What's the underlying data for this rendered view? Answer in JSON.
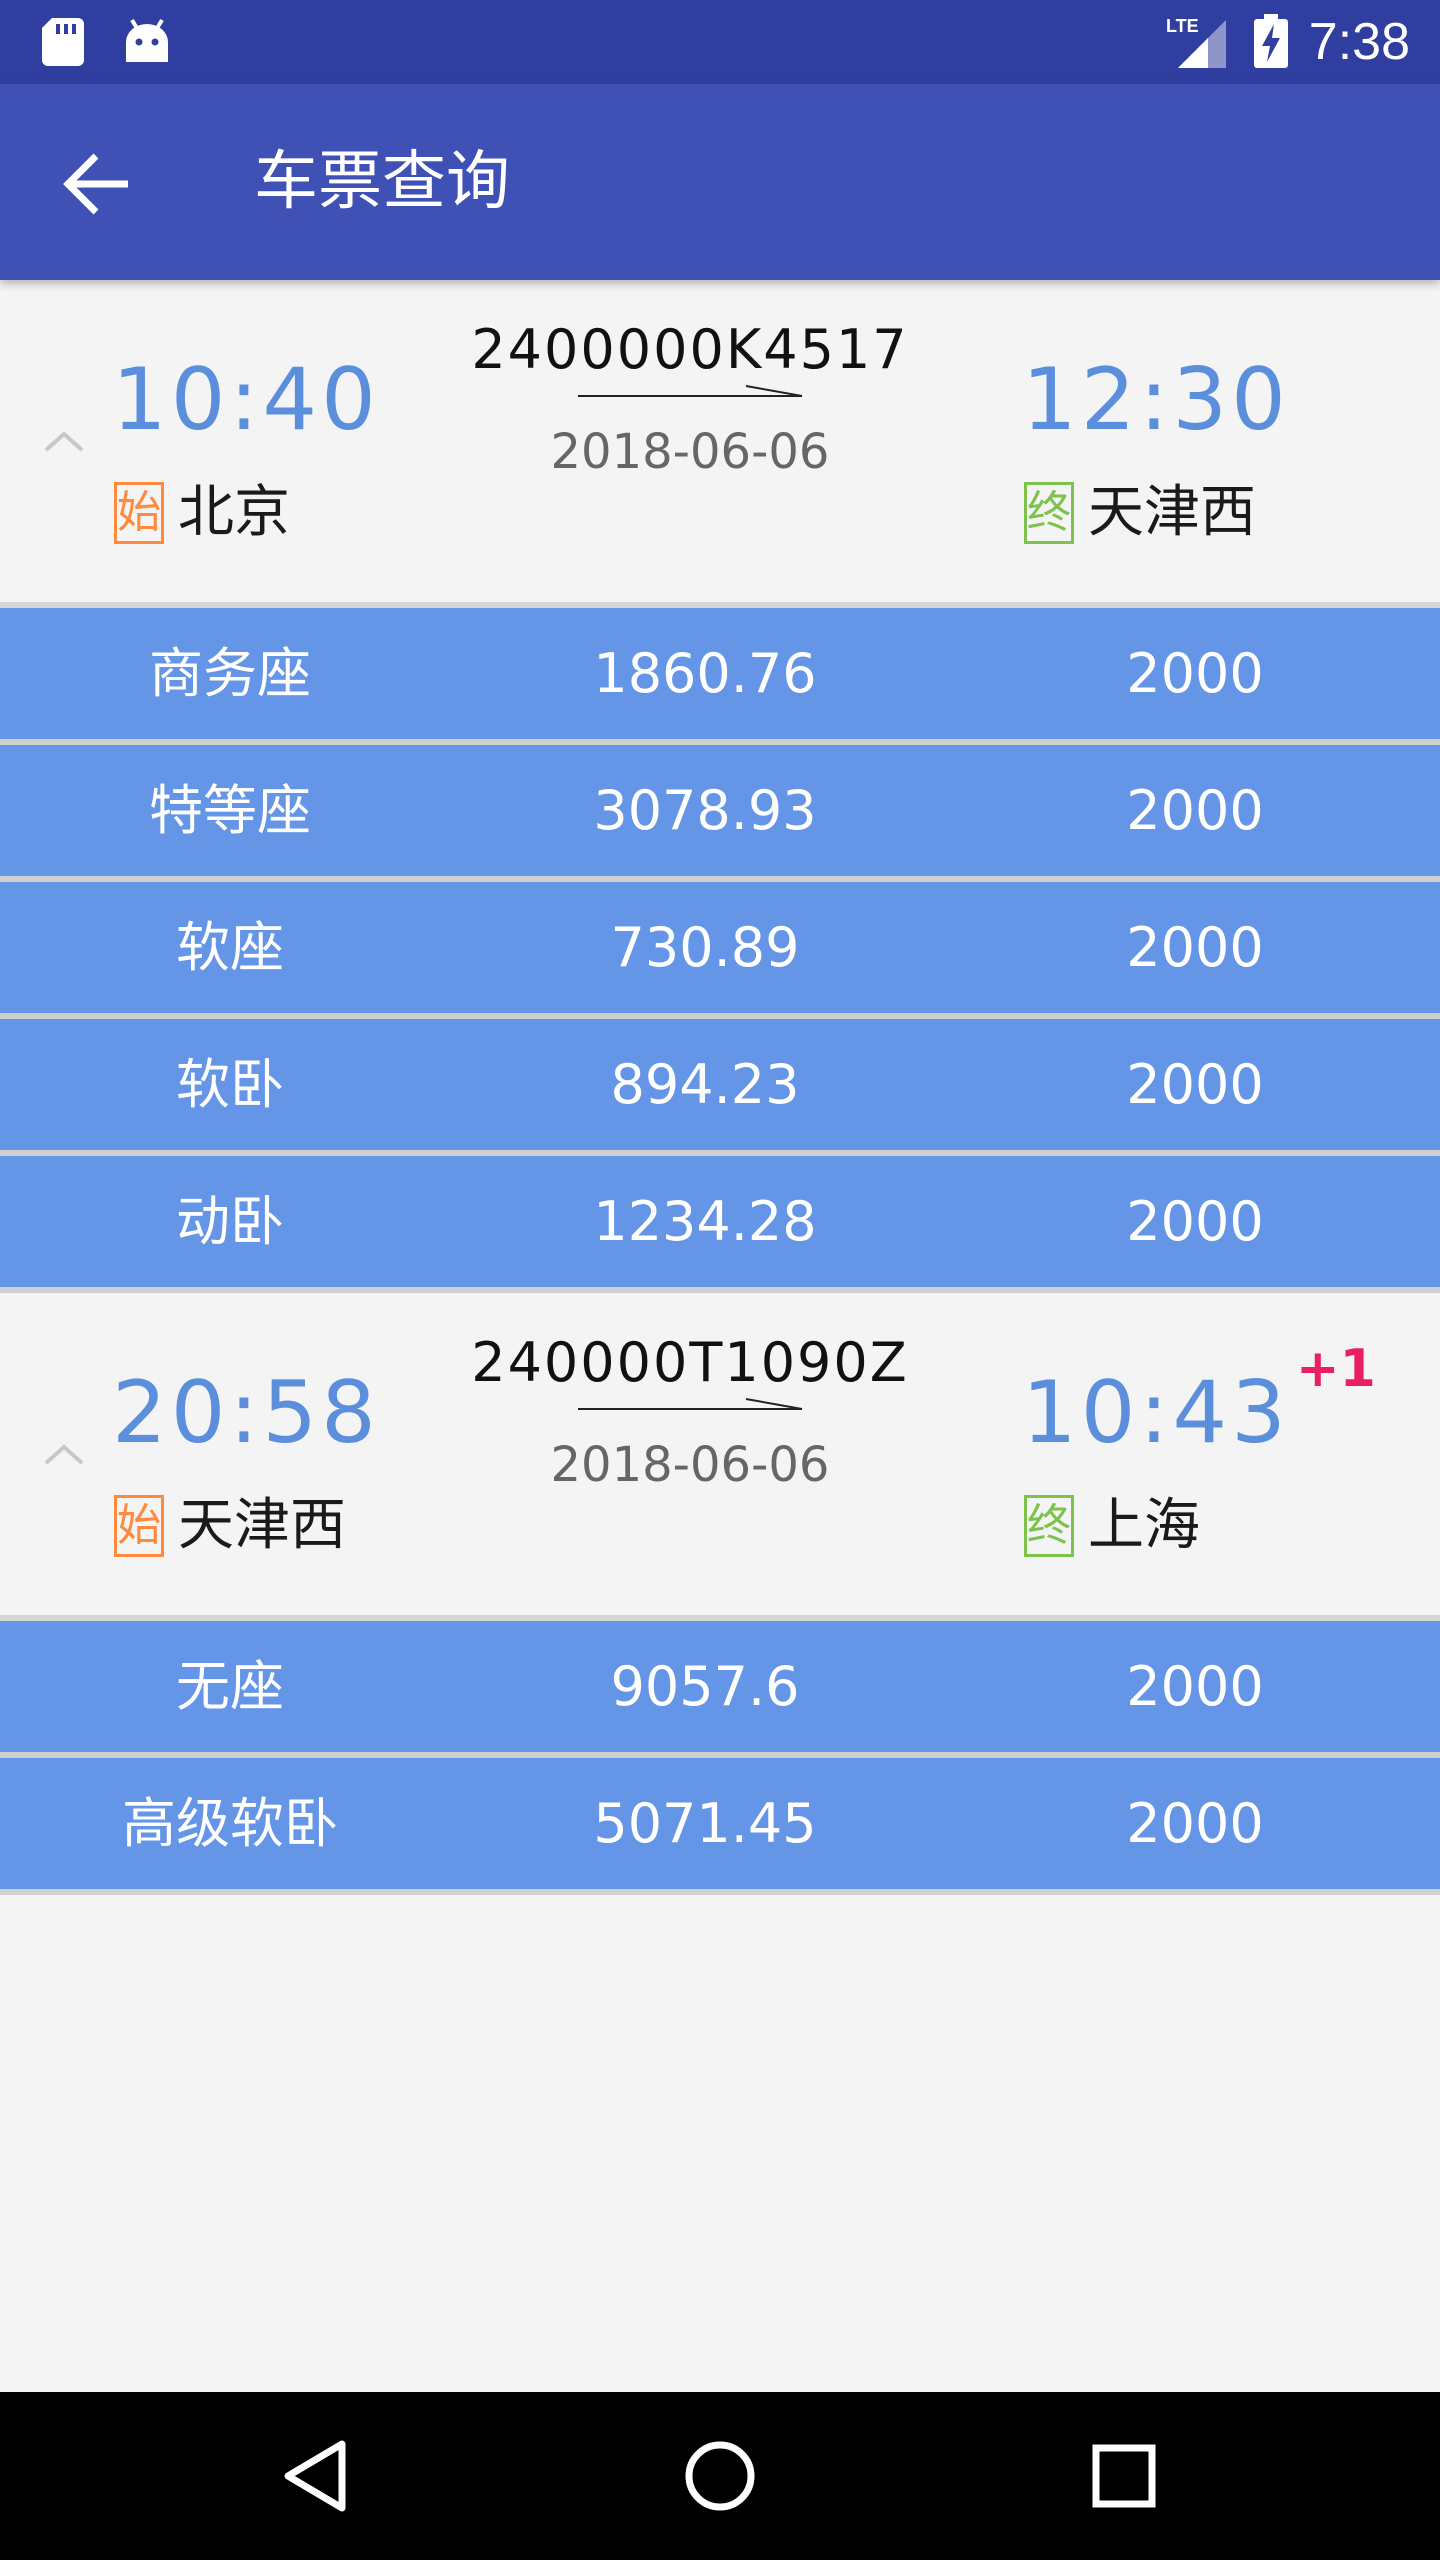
{
  "status_bar": {
    "time": "7:38",
    "icons": [
      "sd-card-icon",
      "android-icon",
      "lte-signal-icon",
      "battery-charging-icon"
    ]
  },
  "app_bar": {
    "title": "车票查询",
    "back_icon": "arrow-left-icon"
  },
  "trains": [
    {
      "train_no": "2400000K4517",
      "date": "2018-06-06",
      "depart_time": "10:40",
      "arrive_time": "12:30",
      "day_offset": "",
      "start_tag": "始",
      "end_tag": "终",
      "from_station": "北京",
      "to_station": "天津西",
      "seats": [
        {
          "name": "商务座",
          "price": "1860.76",
          "count": "2000"
        },
        {
          "name": "特等座",
          "price": "3078.93",
          "count": "2000"
        },
        {
          "name": "软座",
          "price": "730.89",
          "count": "2000"
        },
        {
          "name": "软卧",
          "price": "894.23",
          "count": "2000"
        },
        {
          "name": "动卧",
          "price": "1234.28",
          "count": "2000"
        }
      ]
    },
    {
      "train_no": "240000T1090Z",
      "date": "2018-06-06",
      "depart_time": "20:58",
      "arrive_time": "10:43",
      "day_offset": "+1",
      "start_tag": "始",
      "end_tag": "终",
      "from_station": "天津西",
      "to_station": "上海",
      "seats": [
        {
          "name": "无座",
          "price": "9057.6",
          "count": "2000"
        },
        {
          "name": "高级软卧",
          "price": "5071.45",
          "count": "2000"
        }
      ]
    }
  ],
  "nav_bar": {
    "icons": [
      "back-triangle-icon",
      "home-circle-icon",
      "recents-square-icon"
    ]
  }
}
